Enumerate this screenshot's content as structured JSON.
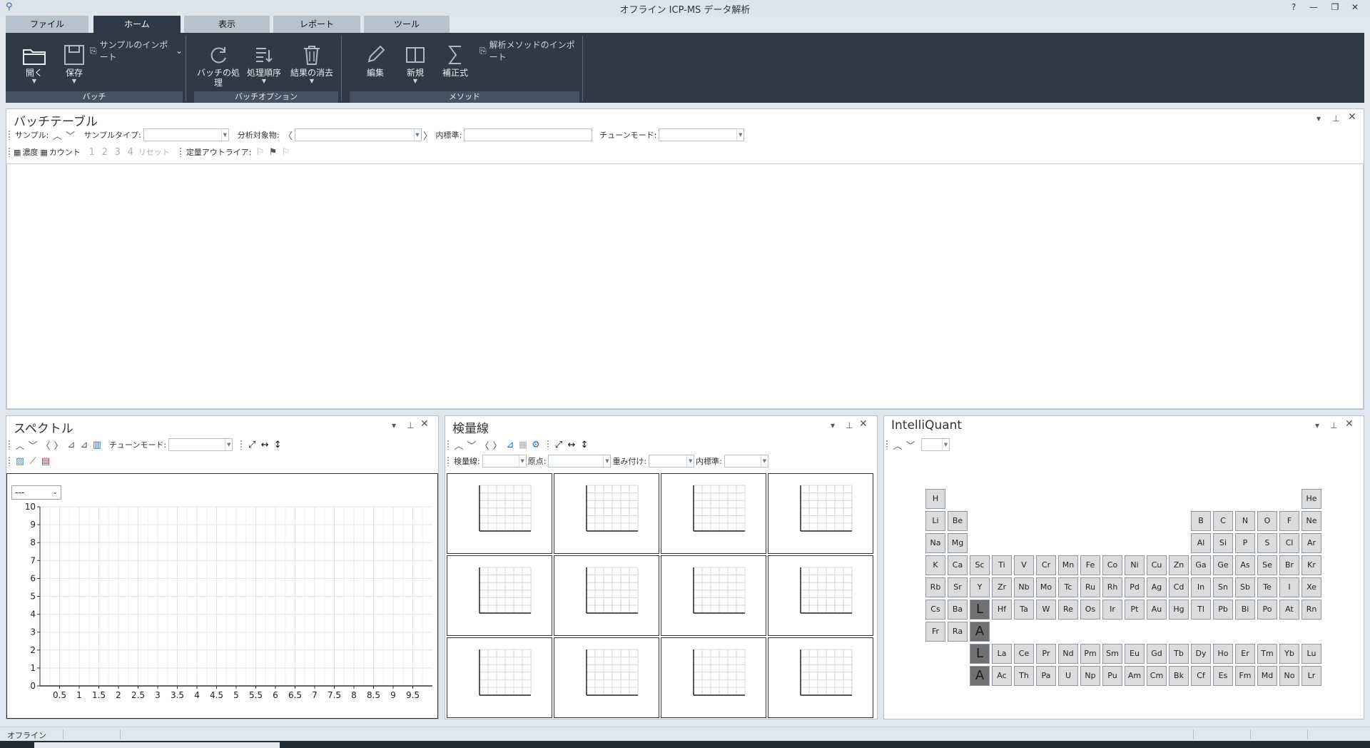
{
  "window": {
    "title": "オフライン ICP-MS データ解析",
    "help": "?",
    "minimize": "—",
    "restore": "❐",
    "close": "✕"
  },
  "tabs": [
    "ファイル",
    "ホーム",
    "表示",
    "レポート",
    "ツール"
  ],
  "ribbon": {
    "open": "開く",
    "save": "保存",
    "sample_import": "サンプルのインポート",
    "group_batch": "バッチ",
    "process_batch": "バッチの処理",
    "process_order": "処理順序",
    "clear_results": "結果の消去",
    "group_batch_options": "バッチオプション",
    "edit": "編集",
    "new": "新規",
    "correction": "補正式",
    "import_method": "解析メソッドのインポート",
    "group_method": "メソッド"
  },
  "batch_table": {
    "title": "バッチテーブル",
    "sample_label": "サンプル:",
    "sample_type_label": "サンプルタイプ:",
    "analyte_label": "分析対象物:",
    "istd_label": "内標準:",
    "tune_mode_label": "チューンモード:",
    "conc_label": "濃度",
    "count_label": "カウント",
    "btn1": "1",
    "btn2": "2",
    "btn3": "3",
    "btn4": "4",
    "reset": "リセット",
    "outlier_label": "定量アウトライア:"
  },
  "spectrum": {
    "title": "スペクトル",
    "tune_mode_label": "チューンモード:",
    "selector": "---",
    "chart_data": {
      "type": "line",
      "xlabel": "",
      "ylabel": "",
      "xlim": [
        0,
        10
      ],
      "ylim": [
        0,
        10
      ],
      "x_ticks": [
        "0.5",
        "1",
        "1.5",
        "2",
        "2.5",
        "3",
        "3.5",
        "4",
        "4.5",
        "5",
        "5.5",
        "6",
        "6.5",
        "7",
        "7.5",
        "8",
        "8.5",
        "9",
        "9.5"
      ],
      "y_ticks": [
        "0",
        "1",
        "2",
        "3",
        "4",
        "5",
        "6",
        "7",
        "8",
        "9",
        "10"
      ],
      "grid": true,
      "series": []
    }
  },
  "calibration": {
    "title": "検量線",
    "curve_label": "検量線:",
    "origin_label": "原点:",
    "weight_label": "重み付け:",
    "istd_label": "内標準:",
    "cells": 12
  },
  "intelliquant": {
    "title": "IntelliQuant",
    "elements": [
      {
        "s": "H",
        "r": 0,
        "c": 0
      },
      {
        "s": "He",
        "r": 0,
        "c": 17
      },
      {
        "s": "Li",
        "r": 1,
        "c": 0
      },
      {
        "s": "Be",
        "r": 1,
        "c": 1
      },
      {
        "s": "B",
        "r": 1,
        "c": 12
      },
      {
        "s": "C",
        "r": 1,
        "c": 13
      },
      {
        "s": "N",
        "r": 1,
        "c": 14
      },
      {
        "s": "O",
        "r": 1,
        "c": 15
      },
      {
        "s": "F",
        "r": 1,
        "c": 16
      },
      {
        "s": "Ne",
        "r": 1,
        "c": 17
      },
      {
        "s": "Na",
        "r": 2,
        "c": 0
      },
      {
        "s": "Mg",
        "r": 2,
        "c": 1
      },
      {
        "s": "Al",
        "r": 2,
        "c": 12
      },
      {
        "s": "Si",
        "r": 2,
        "c": 13
      },
      {
        "s": "P",
        "r": 2,
        "c": 14
      },
      {
        "s": "S",
        "r": 2,
        "c": 15
      },
      {
        "s": "Cl",
        "r": 2,
        "c": 16
      },
      {
        "s": "Ar",
        "r": 2,
        "c": 17
      },
      {
        "s": "K",
        "r": 3,
        "c": 0
      },
      {
        "s": "Ca",
        "r": 3,
        "c": 1
      },
      {
        "s": "Sc",
        "r": 3,
        "c": 2
      },
      {
        "s": "Ti",
        "r": 3,
        "c": 3
      },
      {
        "s": "V",
        "r": 3,
        "c": 4
      },
      {
        "s": "Cr",
        "r": 3,
        "c": 5
      },
      {
        "s": "Mn",
        "r": 3,
        "c": 6
      },
      {
        "s": "Fe",
        "r": 3,
        "c": 7
      },
      {
        "s": "Co",
        "r": 3,
        "c": 8
      },
      {
        "s": "Ni",
        "r": 3,
        "c": 9
      },
      {
        "s": "Cu",
        "r": 3,
        "c": 10
      },
      {
        "s": "Zn",
        "r": 3,
        "c": 11
      },
      {
        "s": "Ga",
        "r": 3,
        "c": 12
      },
      {
        "s": "Ge",
        "r": 3,
        "c": 13
      },
      {
        "s": "As",
        "r": 3,
        "c": 14
      },
      {
        "s": "Se",
        "r": 3,
        "c": 15
      },
      {
        "s": "Br",
        "r": 3,
        "c": 16
      },
      {
        "s": "Kr",
        "r": 3,
        "c": 17
      },
      {
        "s": "Rb",
        "r": 4,
        "c": 0
      },
      {
        "s": "Sr",
        "r": 4,
        "c": 1
      },
      {
        "s": "Y",
        "r": 4,
        "c": 2
      },
      {
        "s": "Zr",
        "r": 4,
        "c": 3
      },
      {
        "s": "Nb",
        "r": 4,
        "c": 4
      },
      {
        "s": "Mo",
        "r": 4,
        "c": 5
      },
      {
        "s": "Tc",
        "r": 4,
        "c": 6
      },
      {
        "s": "Ru",
        "r": 4,
        "c": 7
      },
      {
        "s": "Rh",
        "r": 4,
        "c": 8
      },
      {
        "s": "Pd",
        "r": 4,
        "c": 9
      },
      {
        "s": "Ag",
        "r": 4,
        "c": 10
      },
      {
        "s": "Cd",
        "r": 4,
        "c": 11
      },
      {
        "s": "In",
        "r": 4,
        "c": 12
      },
      {
        "s": "Sn",
        "r": 4,
        "c": 13
      },
      {
        "s": "Sb",
        "r": 4,
        "c": 14
      },
      {
        "s": "Te",
        "r": 4,
        "c": 15
      },
      {
        "s": "I",
        "r": 4,
        "c": 16
      },
      {
        "s": "Xe",
        "r": 4,
        "c": 17
      },
      {
        "s": "Cs",
        "r": 5,
        "c": 0
      },
      {
        "s": "Ba",
        "r": 5,
        "c": 1
      },
      {
        "s": "L",
        "r": 5,
        "c": 2,
        "big": true
      },
      {
        "s": "Hf",
        "r": 5,
        "c": 3
      },
      {
        "s": "Ta",
        "r": 5,
        "c": 4
      },
      {
        "s": "W",
        "r": 5,
        "c": 5
      },
      {
        "s": "Re",
        "r": 5,
        "c": 6
      },
      {
        "s": "Os",
        "r": 5,
        "c": 7
      },
      {
        "s": "Ir",
        "r": 5,
        "c": 8
      },
      {
        "s": "Pt",
        "r": 5,
        "c": 9
      },
      {
        "s": "Au",
        "r": 5,
        "c": 10
      },
      {
        "s": "Hg",
        "r": 5,
        "c": 11
      },
      {
        "s": "Tl",
        "r": 5,
        "c": 12
      },
      {
        "s": "Pb",
        "r": 5,
        "c": 13
      },
      {
        "s": "Bi",
        "r": 5,
        "c": 14
      },
      {
        "s": "Po",
        "r": 5,
        "c": 15
      },
      {
        "s": "At",
        "r": 5,
        "c": 16
      },
      {
        "s": "Rn",
        "r": 5,
        "c": 17
      },
      {
        "s": "Fr",
        "r": 6,
        "c": 0
      },
      {
        "s": "Ra",
        "r": 6,
        "c": 1
      },
      {
        "s": "A",
        "r": 6,
        "c": 2,
        "big": true
      },
      {
        "s": "L",
        "r": 7,
        "c": 2,
        "big": true
      },
      {
        "s": "La",
        "r": 7,
        "c": 3
      },
      {
        "s": "Ce",
        "r": 7,
        "c": 4
      },
      {
        "s": "Pr",
        "r": 7,
        "c": 5
      },
      {
        "s": "Nd",
        "r": 7,
        "c": 6
      },
      {
        "s": "Pm",
        "r": 7,
        "c": 7
      },
      {
        "s": "Sm",
        "r": 7,
        "c": 8
      },
      {
        "s": "Eu",
        "r": 7,
        "c": 9
      },
      {
        "s": "Gd",
        "r": 7,
        "c": 10
      },
      {
        "s": "Tb",
        "r": 7,
        "c": 11
      },
      {
        "s": "Dy",
        "r": 7,
        "c": 12
      },
      {
        "s": "Ho",
        "r": 7,
        "c": 13
      },
      {
        "s": "Er",
        "r": 7,
        "c": 14
      },
      {
        "s": "Tm",
        "r": 7,
        "c": 15
      },
      {
        "s": "Yb",
        "r": 7,
        "c": 16
      },
      {
        "s": "Lu",
        "r": 7,
        "c": 17
      },
      {
        "s": "A",
        "r": 8,
        "c": 2,
        "big": true
      },
      {
        "s": "Ac",
        "r": 8,
        "c": 3
      },
      {
        "s": "Th",
        "r": 8,
        "c": 4
      },
      {
        "s": "Pa",
        "r": 8,
        "c": 5
      },
      {
        "s": "U",
        "r": 8,
        "c": 6
      },
      {
        "s": "Np",
        "r": 8,
        "c": 7
      },
      {
        "s": "Pu",
        "r": 8,
        "c": 8
      },
      {
        "s": "Am",
        "r": 8,
        "c": 9
      },
      {
        "s": "Cm",
        "r": 8,
        "c": 10
      },
      {
        "s": "Bk",
        "r": 8,
        "c": 11
      },
      {
        "s": "Cf",
        "r": 8,
        "c": 12
      },
      {
        "s": "Es",
        "r": 8,
        "c": 13
      },
      {
        "s": "Fm",
        "r": 8,
        "c": 14
      },
      {
        "s": "Md",
        "r": 8,
        "c": 15
      },
      {
        "s": "No",
        "r": 8,
        "c": 16
      },
      {
        "s": "Lr",
        "r": 8,
        "c": 17
      }
    ]
  },
  "status": {
    "mode": "オフライン"
  },
  "colors": {
    "ribbon": "#2e3a48",
    "active_tab": "#2e3a48",
    "panel_bg": "#ffffff",
    "chrome": "#dfe6ee"
  }
}
